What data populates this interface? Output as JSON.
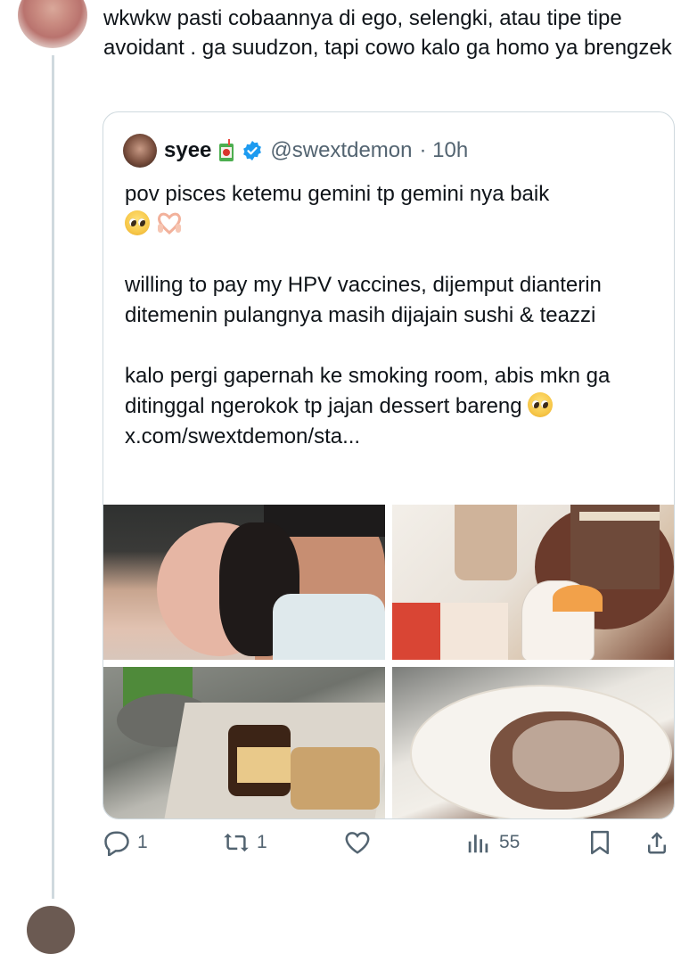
{
  "reply": {
    "text": "wkwkw pasti cobaannya di ego, selengki, atau tipe tipe avoidant . ga suudzon, tapi cowo kalo ga homo ya brengzek"
  },
  "quote": {
    "name": "syee",
    "handle": "@swextdemon",
    "time": "· 10h",
    "line1": "pov pisces ketemu gemini tp gemini nya baik",
    "para2": "willing to pay my HPV vaccines, dijemput dianterin ditemenin pulangnya masih dijajain sushi & teazzi",
    "para3_text": "kalo pergi gapernah ke smoking room, abis mkn ga ditinggal ngerokok tp jajan dessert bareng",
    "link": "x.com/swextdemon/sta..."
  },
  "actions": {
    "replies": "1",
    "reposts": "1",
    "views": "55"
  },
  "colors": {
    "accent": "#1d9bf0",
    "muted": "#536471",
    "border": "#cfd9de"
  }
}
